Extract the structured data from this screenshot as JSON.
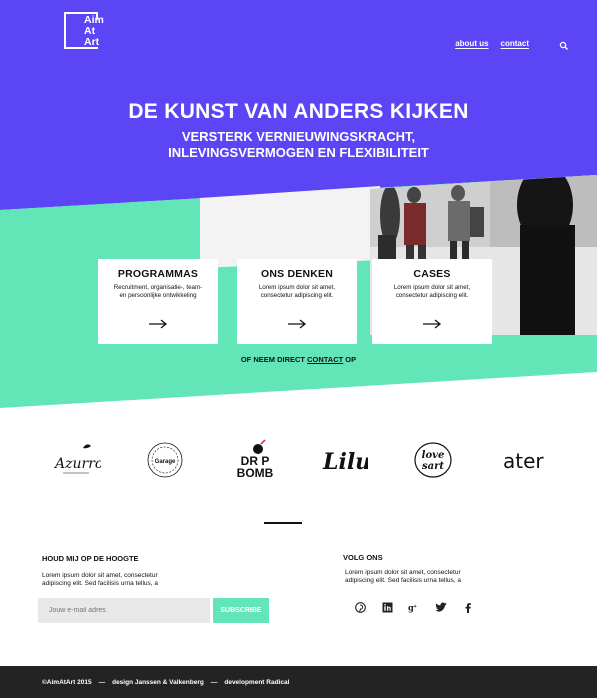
{
  "colors": {
    "purple": "#5b45f5",
    "mint": "#62e6b8",
    "dark": "#232323"
  },
  "logo": {
    "line1": "Aim",
    "line2": "At",
    "line3": "Art"
  },
  "nav": {
    "about": "about us",
    "contact": "contact",
    "search_icon": "search-icon"
  },
  "hero": {
    "headline": "DE KUNST VAN ANDERS KIJKEN",
    "sub1": "VERSTERK VERNIEUWINGSKRACHT,",
    "sub2": "INLEVINGSVERMOGEN EN FLEXIBILITEIT"
  },
  "cards": [
    {
      "title": "PROGRAMMAS",
      "text": "Recruitment, organisatie-, team- en persoonlijke ontwikkeling"
    },
    {
      "title": "ONS DENKEN",
      "text": "Lorem ipsum dolor sit amet, consectetur adipiscing elit."
    },
    {
      "title": "CASES",
      "text": "Lorem ipsum dolor sit amet, consectetur adipiscing elit."
    }
  ],
  "contact_line": {
    "before": "OF NEEM DIRECT ",
    "link": "CONTACT",
    "after": " OP"
  },
  "brands": [
    "Azurro",
    "Garage",
    "DROP BOMB",
    "Lilu",
    "Love Sart",
    "ater"
  ],
  "newsletter": {
    "title": "HOUD MIJ OP DE HOOGTE",
    "text": "Lorem ipsum dolor sit amet, consectetur adipiscing elit. Sed facilisis urna tellus, a",
    "placeholder": "Jouw e-mail adres",
    "button": "SUBSCRIBE"
  },
  "follow": {
    "title": "VOLG ONS",
    "text": "Lorem ipsum dolor sit amet, consectetur adipiscing elit. Sed facilisis urna tellus, a",
    "icons": [
      "pinterest-icon",
      "linkedin-icon",
      "googleplus-icon",
      "twitter-icon",
      "facebook-icon"
    ]
  },
  "footer": {
    "copyright": "©AimAtArt 2015",
    "sep": "—",
    "design": "design Janssen & Valkenberg",
    "development": "development Radical"
  }
}
